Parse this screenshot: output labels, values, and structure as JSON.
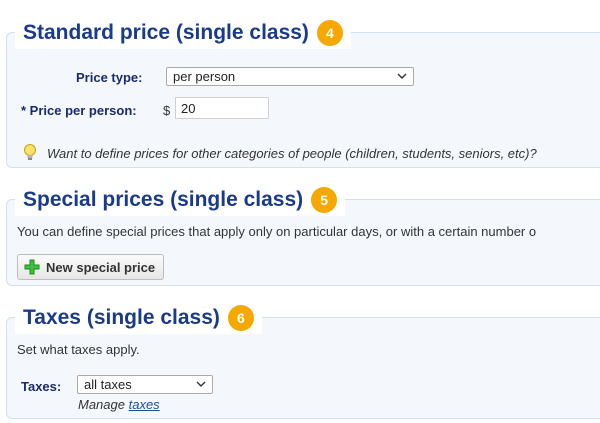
{
  "standard_price": {
    "title": "Standard price (single class)",
    "step": "4",
    "price_type_label": "Price type:",
    "price_type_value": "per person",
    "price_per_person_label": "* Price per person:",
    "currency_symbol": "$",
    "price_value": "20",
    "hint": "Want to define prices for other categories of people (children, students, seniors, etc)?"
  },
  "special_prices": {
    "title": "Special prices (single class)",
    "step": "5",
    "description": "You can define special prices that apply only on particular days, or with a certain number o",
    "new_button_label": "New special price"
  },
  "taxes": {
    "title": "Taxes (single class)",
    "step": "6",
    "description": "Set what taxes apply.",
    "taxes_label": "Taxes:",
    "taxes_value": "all taxes",
    "manage_prefix": "Manage",
    "manage_link": "taxes"
  },
  "colors": {
    "heading": "#1a3a8a",
    "badge": "#f6a800",
    "panel_bg": "#f4f8fd",
    "panel_border": "#d4e0ec"
  },
  "icons": [
    "lightbulb-icon",
    "plus-icon",
    "chevron-down-icon"
  ]
}
